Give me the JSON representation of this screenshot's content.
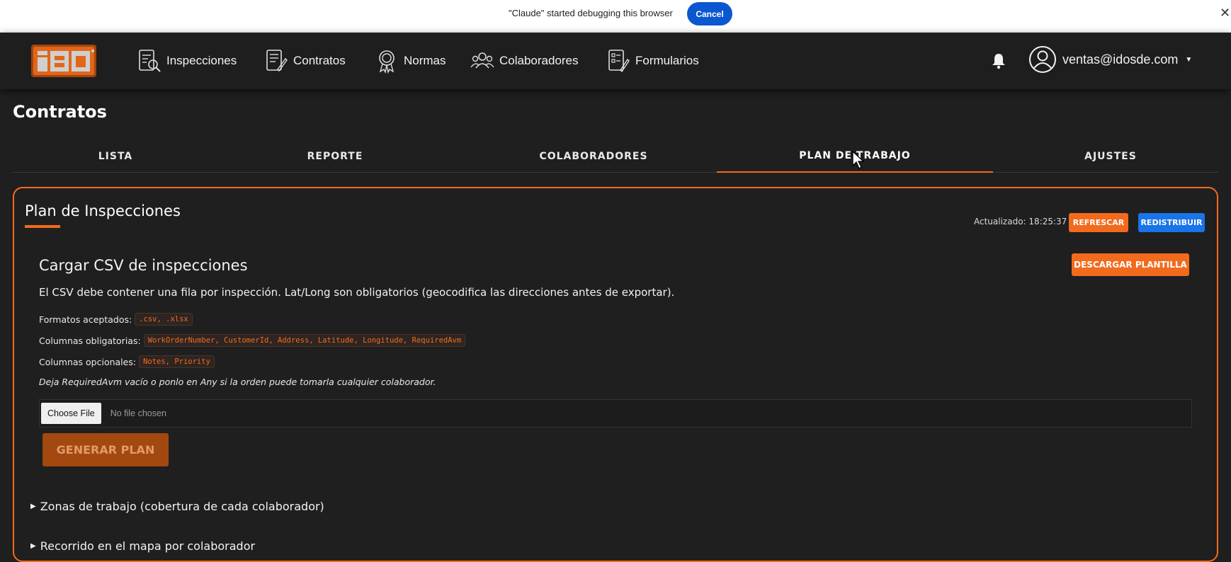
{
  "debug_bar": {
    "message": "\"Claude\" started debugging this browser",
    "cancel_label": "Cancel",
    "close_glyph": "✕"
  },
  "nav": {
    "items": [
      {
        "label": "Inspecciones",
        "icon": "inspection-icon"
      },
      {
        "label": "Contratos",
        "icon": "contract-icon"
      },
      {
        "label": "Normas",
        "icon": "badge-icon"
      },
      {
        "label": "Colaboradores",
        "icon": "people-icon"
      },
      {
        "label": "Formularios",
        "icon": "form-icon"
      }
    ],
    "user_email": "ventas@idosde.com",
    "accent": "#f26b1d"
  },
  "page": {
    "title": "Contratos",
    "tabs": [
      {
        "label": "LISTA",
        "active": false
      },
      {
        "label": "REPORTE",
        "active": false
      },
      {
        "label": "COLABORADORES",
        "active": false
      },
      {
        "label": "PLAN DE TRABAJO",
        "active": true
      },
      {
        "label": "AJUSTES",
        "active": false
      }
    ]
  },
  "plan": {
    "title": "Plan de Inspecciones",
    "updated": "Actualizado: 18:25:37",
    "refresh_label": "REFRESCAR",
    "redistribute_label": "REDISTRIBUIR",
    "csv": {
      "title": "Cargar CSV de inspecciones",
      "template_label": "DESCARGAR PLANTILLA",
      "description": "El CSV debe contener una fila por inspección. Lat/Long son obligatorios (geocodifica las direcciones antes de exportar).",
      "formats_label": "Formatos aceptados:",
      "formats_value": ".csv, .xlsx",
      "required_label": "Columnas obligatorias:",
      "required_value": "WorkOrderNumber, CustomerId, Address, Latitude, Longitude, RequiredAvm",
      "optional_label": "Columnas opcionales:",
      "optional_value": "Notes, Priority",
      "hint": "Deja RequiredAvm vacío o ponlo en Any si la orden puede tomarla cualquier colaborador.",
      "choose_file_label": "Choose File",
      "no_file_label": "No file chosen",
      "generate_label": "GENERAR PLAN"
    },
    "sections": [
      "Zonas de trabajo (cobertura de cada colaborador)",
      "Recorrido en el mapa por colaborador"
    ]
  }
}
